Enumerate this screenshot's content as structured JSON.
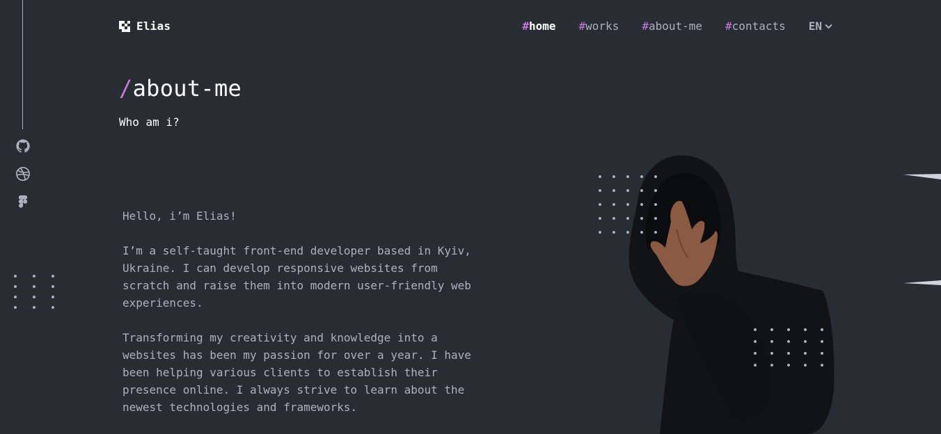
{
  "header": {
    "logo_name": "Elias",
    "nav": [
      {
        "hash": "#",
        "label": "home",
        "active": true
      },
      {
        "hash": "#",
        "label": "works"
      },
      {
        "hash": "#",
        "label": "about-me"
      },
      {
        "hash": "#",
        "label": "contacts"
      }
    ],
    "language": "EN"
  },
  "sidebar": {
    "social": [
      "github-icon",
      "dribbble-icon",
      "figma-icon"
    ]
  },
  "main": {
    "title_prefix": "/",
    "title": "about-me",
    "subtitle": "Who am i?",
    "paragraphs": [
      "Hello, i’m Elias!",
      "I’m a self-taught front-end developer based in Kyiv, Ukraine. I can develop responsive websites from scratch and raise them into modern user-friendly web experiences.",
      "Transforming my creativity and knowledge into a websites has been my passion for over a year. I have been helping various clients to establish their presence online. I always strive to learn about the newest technologies and frameworks."
    ]
  },
  "colors": {
    "background": "#282c33",
    "accent": "#c778dd",
    "text": "#abb2bf",
    "heading": "#ffffff"
  }
}
